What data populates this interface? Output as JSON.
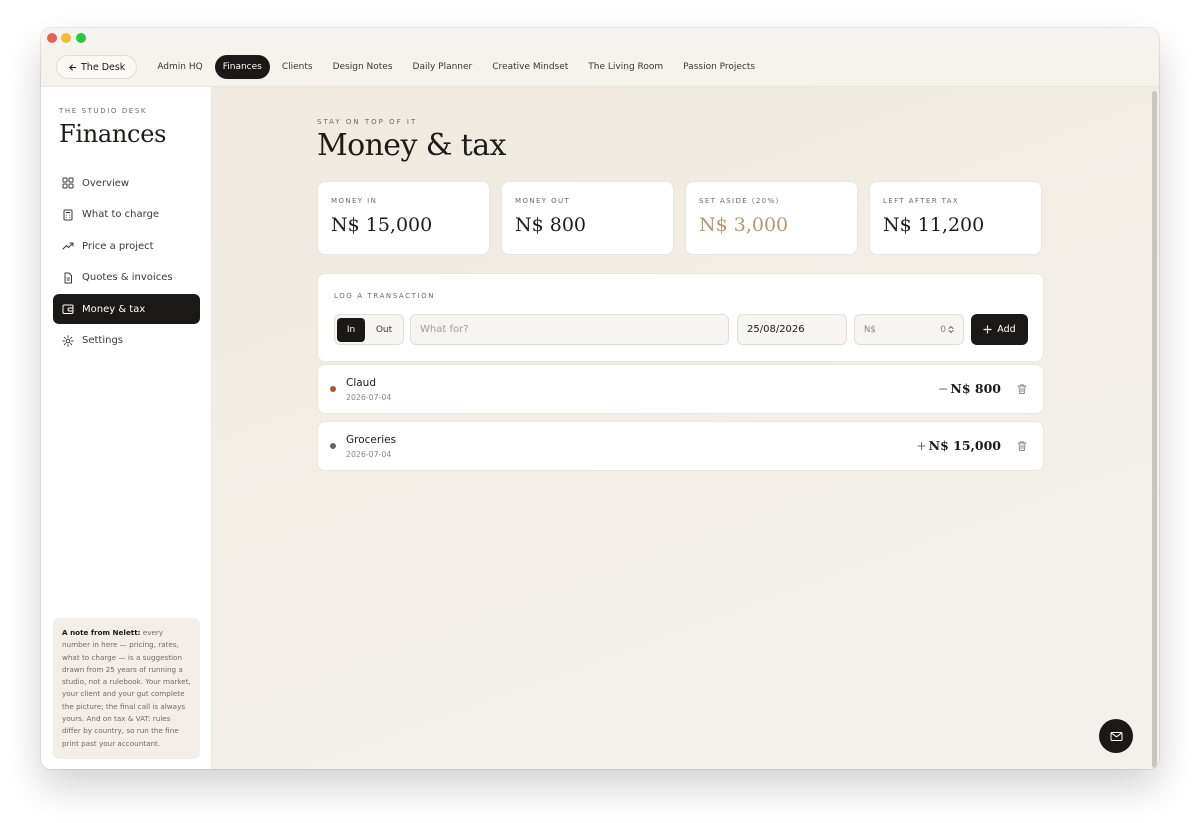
{
  "topnav": {
    "back_label": "The Desk",
    "tabs": [
      {
        "label": "Admin HQ"
      },
      {
        "label": "Finances"
      },
      {
        "label": "Clients"
      },
      {
        "label": "Design Notes"
      },
      {
        "label": "Daily Planner"
      },
      {
        "label": "Creative Mindset"
      },
      {
        "label": "The Living Room"
      },
      {
        "label": "Passion Projects"
      }
    ],
    "active_tab": "Finances"
  },
  "sidebar": {
    "eyebrow": "THE STUDIO DESK",
    "title": "Finances",
    "items": [
      {
        "label": "Overview",
        "icon": "grid-icon"
      },
      {
        "label": "What to charge",
        "icon": "calculator-icon"
      },
      {
        "label": "Price a project",
        "icon": "trend-up-icon"
      },
      {
        "label": "Quotes & invoices",
        "icon": "document-icon"
      },
      {
        "label": "Money & tax",
        "icon": "wallet-icon"
      },
      {
        "label": "Settings",
        "icon": "gear-icon"
      }
    ],
    "active_item": "Money & tax",
    "note": {
      "lead": "A note from Nelett:",
      "body": " every number in here — pricing, rates, what to charge — is a suggestion drawn from 25 years of running a studio, not a rulebook. Your market, your client and your gut complete the picture; the final call is always yours. And on tax & VAT: rules differ by country, so run the fine print past your accountant."
    }
  },
  "main": {
    "eyebrow": "STAY ON TOP OF IT",
    "title": "Money & tax",
    "stats": [
      {
        "label": "MONEY IN",
        "value": "N$ 15,000"
      },
      {
        "label": "MONEY OUT",
        "value": "N$ 800"
      },
      {
        "label": "SET ASIDE (20%)",
        "value": "N$ 3,000"
      },
      {
        "label": "LEFT AFTER TAX",
        "value": "N$ 11,200"
      }
    ],
    "log": {
      "label": "LOG A TRANSACTION",
      "toggle_in": "In",
      "toggle_out": "Out",
      "toggle_selected": "In",
      "what_placeholder": "What for?",
      "date": "25/08/2026",
      "currency": "N$",
      "amount": "0",
      "add_label": "Add"
    },
    "transactions": [
      {
        "name": "Claud",
        "date": "2026-07-04",
        "sign": "−",
        "amount": "N$ 800",
        "dot_color": "#a5543a"
      },
      {
        "name": "Groceries",
        "date": "2026-07-04",
        "sign": "+",
        "amount": "N$ 15,000",
        "dot_color": "#5e6b58"
      }
    ]
  },
  "colors": {
    "accent": "#b39672",
    "dark": "#1a1917",
    "expense_dot": "#a5543a",
    "income_dot": "#5e6b58"
  }
}
